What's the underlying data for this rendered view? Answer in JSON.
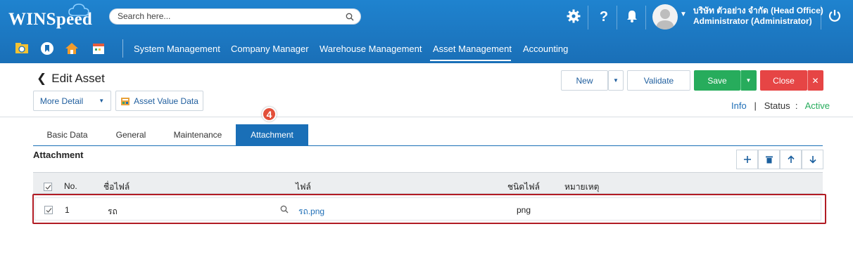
{
  "app": {
    "logo": "WINSpeed"
  },
  "search": {
    "placeholder": "Search here..."
  },
  "header": {
    "company": "บริษัท ตัวอย่าง จำกัด (Head Office)",
    "user": "Administrator (Administrator)"
  },
  "menu": [
    "System Management",
    "Company Manager",
    "Warehouse Management",
    "Asset Management",
    "Accounting"
  ],
  "menu_active": "Asset Management",
  "page": {
    "title": "Edit Asset",
    "more_detail": "More Detail",
    "asset_value": "Asset Value Data",
    "new": "New",
    "validate": "Validate",
    "save": "Save",
    "close": "Close",
    "info": "Info",
    "status_label": "Status",
    "status_value": "Active",
    "step_badge": "4"
  },
  "tabs": [
    "Basic Data",
    "General",
    "Maintenance",
    "Attachment"
  ],
  "tab_active": "Attachment",
  "attachment": {
    "title": "Attachment",
    "columns": [
      "No.",
      "ชื่อไฟล์",
      "ไฟล์",
      "ชนิดไฟล์",
      "หมายเหตุ"
    ],
    "rows": [
      {
        "no": "1",
        "name": "รถ",
        "file": "รถ.png",
        "type": "png",
        "note": ""
      }
    ]
  },
  "colors": {
    "brand": "#1a6fb7",
    "save": "#27ac5c",
    "close": "#e64545",
    "highlight": "#b11c24"
  }
}
